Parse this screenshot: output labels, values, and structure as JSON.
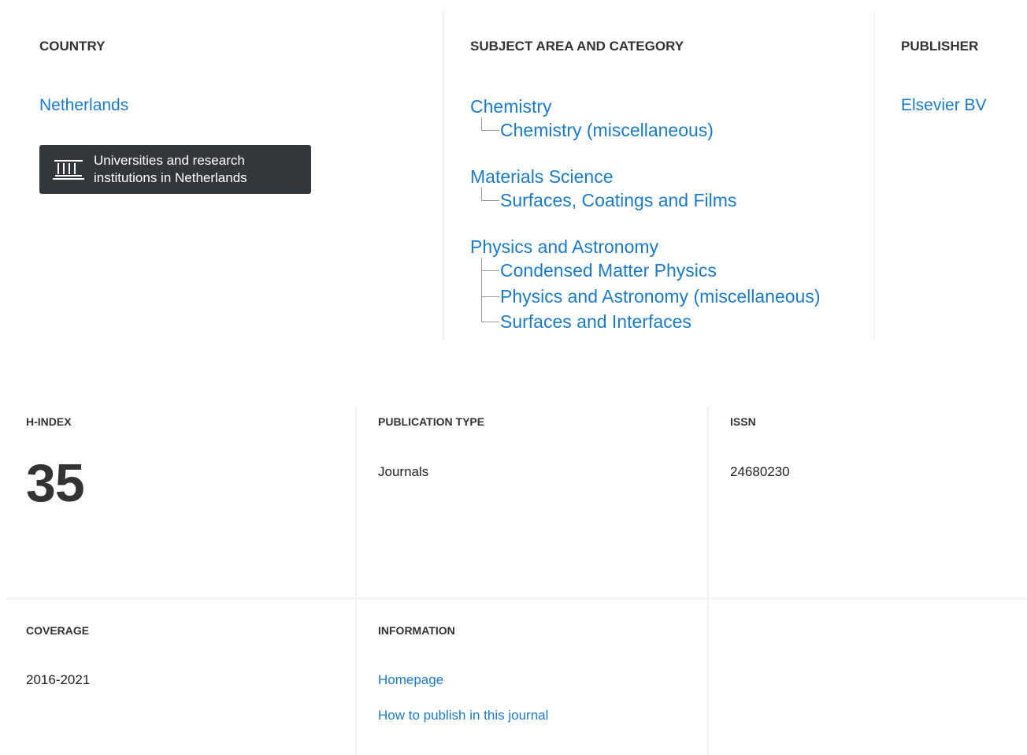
{
  "country": {
    "title": "COUNTRY",
    "name": "Netherlands",
    "institutions_button": {
      "icon": "institution-icon",
      "label": "Universities and research institutions in Netherlands"
    }
  },
  "subject_area": {
    "title": "SUBJECT AREA AND CATEGORY",
    "groups": [
      {
        "area": "Chemistry",
        "categories": [
          "Chemistry (miscellaneous)"
        ]
      },
      {
        "area": "Materials Science",
        "categories": [
          "Surfaces, Coatings and Films"
        ]
      },
      {
        "area": "Physics and Astronomy",
        "categories": [
          "Condensed Matter Physics",
          "Physics and Astronomy (miscellaneous)",
          "Surfaces and Interfaces"
        ]
      }
    ]
  },
  "publisher": {
    "title": "PUBLISHER",
    "name": "Elsevier BV"
  },
  "h_index": {
    "title": "H-INDEX",
    "value": "35"
  },
  "publication_type": {
    "title": "PUBLICATION TYPE",
    "value": "Journals"
  },
  "issn": {
    "title": "ISSN",
    "value": "24680230"
  },
  "coverage": {
    "title": "COVERAGE",
    "value": "2016-2021"
  },
  "information": {
    "title": "INFORMATION",
    "links": [
      "Homepage",
      "How to publish in this journal"
    ]
  },
  "colors": {
    "link": "#1d7bc4",
    "heading": "#333333",
    "button_bg": "#33363b",
    "divider": "#f1f1f1"
  }
}
